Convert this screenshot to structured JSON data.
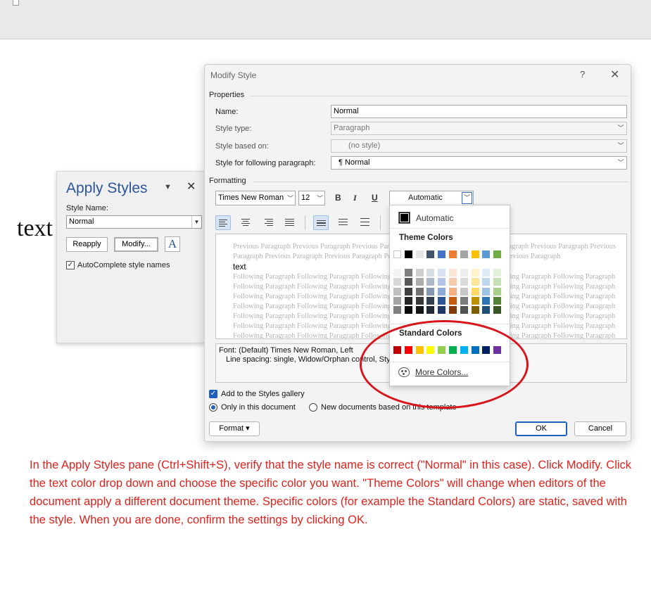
{
  "document": {
    "body_text": "text"
  },
  "apply_styles": {
    "title": "Apply Styles",
    "style_name_label": "Style Name:",
    "style_name_value": "Normal",
    "reapply": "Reapply",
    "modify": "Modify...",
    "styles_icon_glyph": "A",
    "autocomplete_label": "AutoComplete style names",
    "autocomplete_checked": true
  },
  "modify_dialog": {
    "title": "Modify Style",
    "help": "?",
    "properties_header": "Properties",
    "name_label": "Name:",
    "name_value": "Normal",
    "style_type_label": "Style type:",
    "style_type_value": "Paragraph",
    "based_on_label": "Style based on:",
    "based_on_value": "(no style)",
    "following_label": "Style for following paragraph:",
    "following_value": "¶ Normal",
    "formatting_header": "Formatting",
    "font": "Times New Roman",
    "size": "12",
    "bold": "B",
    "italic": "I",
    "underline": "U",
    "color_value": "Automatic",
    "preview": {
      "previous_1": "Previous Paragraph Previous Paragraph Previous Paragraph Previous Paragraph Previous Paragraph Previous Paragraph Previous",
      "previous_2": "Paragraph Previous Paragraph Previous Paragraph Previous Paragraph Previous Paragraph Previous Paragraph",
      "sample": "text",
      "following": [
        "Following Paragraph Following Paragraph Following Paragraph Following Paragraph Following Paragraph Following Paragraph",
        "Following Paragraph Following Paragraph Following Paragraph Following Paragraph Following Paragraph Following Paragraph",
        "Following Paragraph Following Paragraph Following Paragraph Following Paragraph Following Paragraph Following Paragraph",
        "Following Paragraph Following Paragraph Following Paragraph Following Paragraph Following Paragraph Following Paragraph",
        "Following Paragraph Following Paragraph Following Paragraph Following Paragraph Following Paragraph Following Paragraph",
        "Following Paragraph Following Paragraph Following Paragraph Following Paragraph Following Paragraph Following Paragraph",
        "Following Paragraph Following Paragraph Following Paragraph Following Paragraph Following Paragraph Following Paragraph"
      ]
    },
    "description_line1": "Font: (Default) Times New Roman, Left",
    "description_line2": "Line spacing:  single, Widow/Orphan control, Style: Show in the Styles gallery",
    "add_to_gallery": "Add to the Styles gallery",
    "only_this_doc": "Only in this document",
    "new_docs": "New documents based on this template",
    "format_button": "Format ▾",
    "ok": "OK",
    "cancel": "Cancel"
  },
  "color_menu": {
    "automatic": "Automatic",
    "theme_header": "Theme Colors",
    "standard_header": "Standard Colors",
    "more_colors": "More Colors...",
    "theme_top": [
      "#ffffff",
      "#000000",
      "#e7e6e6",
      "#44546a",
      "#4472c4",
      "#ed7d31",
      "#a5a5a5",
      "#ffc000",
      "#5b9bd5",
      "#70ad47"
    ],
    "theme_shades": [
      [
        "#f2f2f2",
        "#7f7f7f",
        "#d0cece",
        "#d6dce4",
        "#d9e2f3",
        "#fbe5d5",
        "#ededed",
        "#fff2cc",
        "#deebf6",
        "#e2efd9"
      ],
      [
        "#d8d8d8",
        "#595959",
        "#aeabab",
        "#adb9ca",
        "#b4c6e7",
        "#f7cbac",
        "#dbdbdb",
        "#fee599",
        "#bdd7ee",
        "#c5e0b3"
      ],
      [
        "#bfbfbf",
        "#3f3f3f",
        "#757070",
        "#8496b0",
        "#8eaadb",
        "#f4b183",
        "#c9c9c9",
        "#ffd965",
        "#9cc3e5",
        "#a8d08d"
      ],
      [
        "#a5a5a5",
        "#262626",
        "#3a3838",
        "#323f4f",
        "#2f5496",
        "#c55a11",
        "#7b7b7b",
        "#bf9000",
        "#2e75b5",
        "#538135"
      ],
      [
        "#7f7f7f",
        "#0c0c0c",
        "#171616",
        "#222a35",
        "#1f3864",
        "#833c0b",
        "#525252",
        "#7f6000",
        "#1f4e79",
        "#375623"
      ]
    ],
    "standard": [
      "#c00000",
      "#ff0000",
      "#ffc000",
      "#ffff00",
      "#92d050",
      "#00b050",
      "#00b0f0",
      "#0070c0",
      "#002060",
      "#7030a0"
    ]
  },
  "caption": "In the Apply Styles pane (Ctrl+Shift+S), verify that the style name is correct (\"Normal\" in this case). Click Modify. Click the text color drop down and choose the specific color you want. \"Theme Colors\" will change when editors of the document apply a different document theme. Specific colors (for example the Standard Colors) are static, saved with the style. When you are done, confirm the settings by clicking OK.",
  "highlight_color": "#d9141b"
}
